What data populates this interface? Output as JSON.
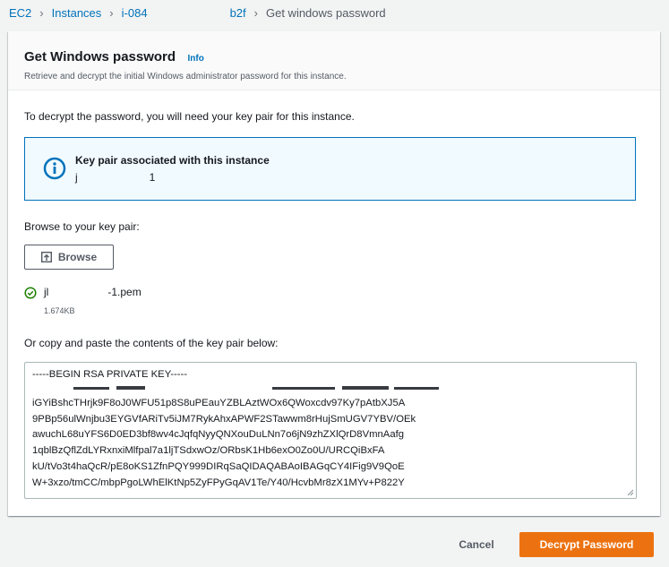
{
  "breadcrumb": {
    "ec2": "EC2",
    "instances": "Instances",
    "instance_prefix": "i-084",
    "instance_suffix": "b2f",
    "current": "Get windows password"
  },
  "panel": {
    "title": "Get Windows password",
    "info": "Info",
    "description": "Retrieve and decrypt the initial Windows administrator password for this instance."
  },
  "intro": "To decrypt the password, you will need your key pair for this instance.",
  "alert": {
    "title": "Key pair associated with this instance",
    "value_prefix": "j",
    "value_suffix": "1"
  },
  "browse": {
    "label": "Browse to your key pair:",
    "button": "Browse"
  },
  "file": {
    "name_prefix": "jl",
    "name_suffix": "-1.pem",
    "size": "1.674KB"
  },
  "paste_label": "Or copy and paste the contents of the key pair below:",
  "key_lines": [
    "-----BEGIN RSA PRIVATE KEY-----",
    "iGYiBshcTHrjk9F8oJ0WFU51p8S8uPEauYZBLAztWOx6QWoxcdv97Ky7pAtbXJ5A",
    "9PBp56ulWnjbu3EYGVfARiTv5iJM7RykAhxAPWF2STawwm8rHujSmUGV7YBV/OEk",
    "awuchL68uYFS6D0ED3bf8wv4cJqfqNyyQNXouDuLNn7o6jN9zhZXlQrD8VmnAafg",
    "1qblBzQflZdLYRxnxiMlfpal7a1ljTSdxwOz/ORbsK1Hb6exO0Zo0U/URCQiBxFA",
    "kU/tVo3t4haQcR/pE8oKS1ZfnPQY999DIRqSaQIDAQABAoIBAGqCY4IFig9V9QoE",
    "W+3xzo/tmCC/mbpPgoLWhElKtNp5ZyFPyGqAV1Te/Y40/HcvbMr8zX1MYv+P822Y"
  ],
  "footer": {
    "cancel": "Cancel",
    "decrypt": "Decrypt Password"
  },
  "colors": {
    "link": "#0073bb",
    "primary": "#ec7211",
    "success": "#1d8102"
  }
}
